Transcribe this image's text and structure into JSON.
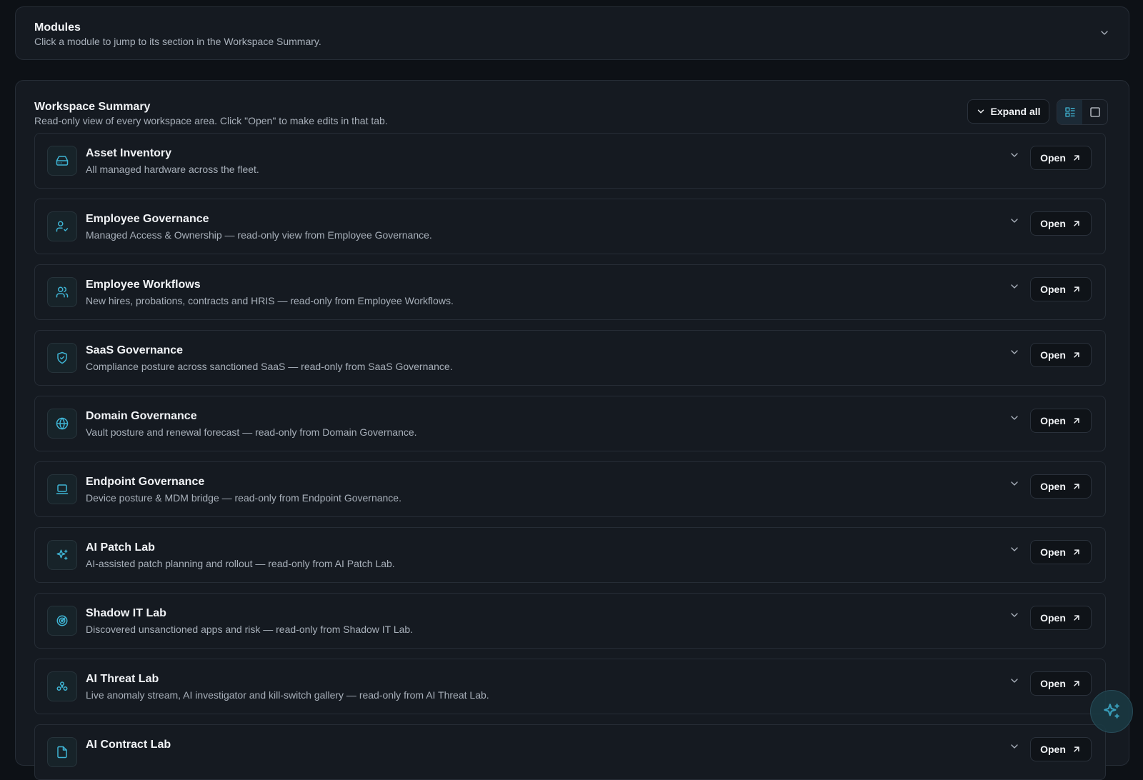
{
  "modules": {
    "title": "Modules",
    "subtitle": "Click a module to jump to its section in the Workspace Summary."
  },
  "summary": {
    "title": "Workspace Summary",
    "subtitle": "Read-only view of every workspace area. Click \"Open\" to make edits in that tab.",
    "expand_all_label": "Expand all"
  },
  "colors": {
    "accent": "#3fb4d4",
    "background": "#0d1116",
    "panel": "#151a21"
  },
  "cards": [
    {
      "title": "Asset Inventory",
      "subtitle": "All managed hardware across the fleet.",
      "icon": "hard-drive-icon",
      "open_label": "Open"
    },
    {
      "title": "Employee Governance",
      "subtitle": "Managed Access & Ownership — read-only view from Employee Governance.",
      "icon": "user-check-icon",
      "open_label": "Open"
    },
    {
      "title": "Employee Workflows",
      "subtitle": "New hires, probations, contracts and HRIS — read-only from Employee Workflows.",
      "icon": "users-icon",
      "open_label": "Open"
    },
    {
      "title": "SaaS Governance",
      "subtitle": "Compliance posture across sanctioned SaaS — read-only from SaaS Governance.",
      "icon": "shield-check-icon",
      "open_label": "Open"
    },
    {
      "title": "Domain Governance",
      "subtitle": "Vault posture and renewal forecast — read-only from Domain Governance.",
      "icon": "globe-icon",
      "open_label": "Open"
    },
    {
      "title": "Endpoint Governance",
      "subtitle": "Device posture & MDM bridge — read-only from Endpoint Governance.",
      "icon": "laptop-icon",
      "open_label": "Open"
    },
    {
      "title": "AI Patch Lab",
      "subtitle": "AI-assisted patch planning and rollout — read-only from AI Patch Lab.",
      "icon": "sparkles-icon",
      "open_label": "Open"
    },
    {
      "title": "Shadow IT Lab",
      "subtitle": "Discovered unsanctioned apps and risk — read-only from Shadow IT Lab.",
      "icon": "radar-icon",
      "open_label": "Open"
    },
    {
      "title": "AI Threat Lab",
      "subtitle": "Live anomaly stream, AI investigator and kill-switch gallery — read-only from AI Threat Lab.",
      "icon": "biohazard-icon",
      "open_label": "Open"
    },
    {
      "title": "AI Contract Lab",
      "subtitle": "",
      "icon": "file-icon",
      "open_label": "Open"
    }
  ]
}
